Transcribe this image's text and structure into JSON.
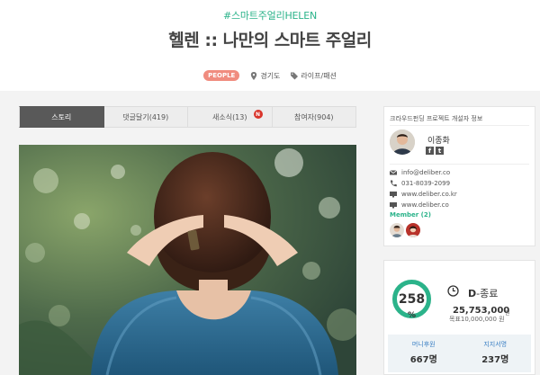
{
  "header": {
    "hashtag": "#스마트주얼리HELEN",
    "title": "헬렌 :: 나만의 스마트 주얼리",
    "badge": "PEOPLE",
    "location": "경기도",
    "category": "라이프/패션"
  },
  "tabs": [
    {
      "label": "스토리"
    },
    {
      "label": "댓글달기(419)"
    },
    {
      "label": "새소식(13)",
      "badge": "N"
    },
    {
      "label": "참여자(904)"
    }
  ],
  "sidebar": {
    "heading": "크라우드펀딩 프로젝트 개설자 정보",
    "creator_name": "이종화",
    "social": [
      "f",
      "t"
    ],
    "email": "info@deliber.co",
    "phone": "031-8039-2099",
    "website1": "www.deliber.co.kr",
    "website2": "www.deliber.co",
    "member_label": "Member (2)"
  },
  "funding": {
    "percent": "258",
    "percent_symbol": "%",
    "percent_value": 258,
    "dday": "D",
    "dday_status": "-종료",
    "amount": "25,753,000",
    "amount_unit": "원",
    "goal_label": "목표10,000,000 원",
    "goal_unit": "원",
    "stats": [
      {
        "label": "머니후원",
        "value": "667명"
      },
      {
        "label": "지지서명",
        "value": "237명"
      }
    ]
  },
  "colors": {
    "accent": "#2bb38a",
    "badge": "#f08c7f",
    "active_tab": "#595959",
    "new_badge": "#d9342b",
    "stat_label": "#3a7fc4"
  }
}
